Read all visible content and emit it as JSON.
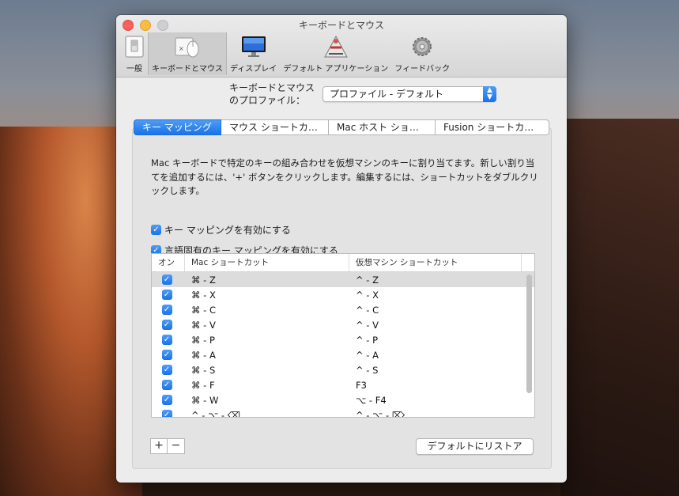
{
  "window": {
    "title": "キーボードとマウス"
  },
  "toolbar": {
    "items": [
      {
        "label": "一般",
        "icon": "general-switch-icon"
      },
      {
        "label": "キーボードとマウス",
        "icon": "keyboard-mouse-icon"
      },
      {
        "label": "ディスプレイ",
        "icon": "display-icon"
      },
      {
        "label": "デフォルト アプリケーション",
        "icon": "default-apps-icon"
      },
      {
        "label": "フィードバック",
        "icon": "feedback-gear-icon"
      }
    ]
  },
  "profile": {
    "label_line1": "キーボードとマウス",
    "label_line2": "のプロファイル：",
    "selected": "プロファイル - デフォルト"
  },
  "tabs": [
    "キー マッピング",
    "マウス ショートカ…",
    "Mac ホスト ショ…",
    "Fusion ショートカ…"
  ],
  "description": "Mac キーボードで特定のキーの組み合わせを仮想マシンのキーに割り当てます。新しい割り当てを追加するには、'+' ボタンをクリックします。編集するには、ショートカットをダブルクリックします。",
  "options": {
    "enable_key_mapping": "キー マッピングを有効にする",
    "enable_language_mapping": "言語固有のキー マッピングを有効にする"
  },
  "table": {
    "headers": {
      "on": "オン",
      "mac": "Mac ショートカット",
      "vm": "仮想マシン ショートカット"
    },
    "rows": [
      {
        "mac": "⌘ - Z",
        "vm": "^ - Z"
      },
      {
        "mac": "⌘ - X",
        "vm": "^ - X"
      },
      {
        "mac": "⌘ - C",
        "vm": "^ - C"
      },
      {
        "mac": "⌘ - V",
        "vm": "^ - V"
      },
      {
        "mac": "⌘ - P",
        "vm": "^ - P"
      },
      {
        "mac": "⌘ - A",
        "vm": "^ - A"
      },
      {
        "mac": "⌘ - S",
        "vm": "^ - S"
      },
      {
        "mac": "⌘ - F",
        "vm": "F3"
      },
      {
        "mac": "⌘ - W",
        "vm": "⌥ - F4"
      },
      {
        "mac": "^ - ⌥ - ⌫",
        "vm": "^ - ⌥ - ⌦"
      }
    ]
  },
  "buttons": {
    "add": "+",
    "remove": "−",
    "restore": "デフォルトにリストア"
  }
}
